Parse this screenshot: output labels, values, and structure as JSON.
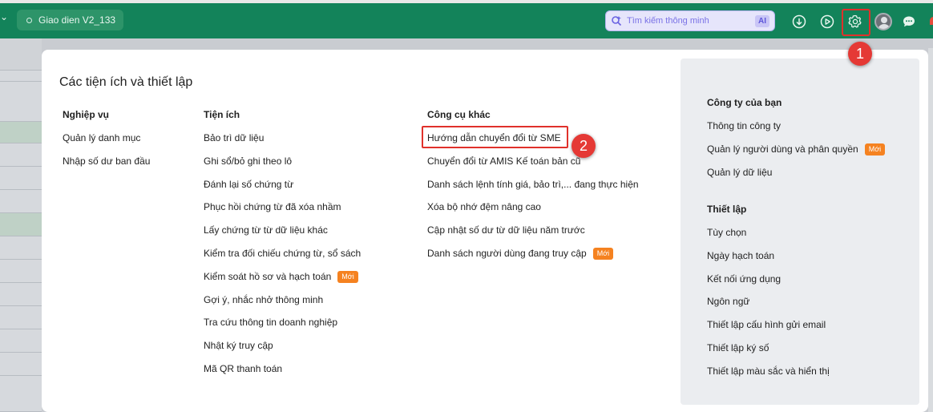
{
  "topbar": {
    "db_name": "Giao dien V2_133",
    "search_placeholder": "Tìm kiếm thông minh",
    "ai_label": "AI"
  },
  "panel": {
    "title": "Các tiện ích và thiết lập",
    "columns": [
      {
        "heading": "Nghiệp vụ",
        "items": [
          "Quản lý danh mục",
          "Nhập số dư ban đầu"
        ]
      },
      {
        "heading": "Tiện ích",
        "items": [
          "Bảo trì dữ liệu",
          "Ghi sổ/bỏ ghi theo lô",
          "Đánh lại số chứng từ",
          "Phục hồi chứng từ đã xóa nhầm",
          "Lấy chứng từ từ dữ liệu khác",
          "Kiểm tra đối chiếu chứng từ, sổ sách",
          "Kiểm soát hồ sơ và hạch toán",
          "Gợi ý, nhắc nhở thông minh",
          "Tra cứu thông tin doanh nghiệp",
          "Nhật ký truy cập",
          "Mã QR thanh toán"
        ]
      },
      {
        "heading": "Công cụ khác",
        "items": [
          "Hướng dẫn chuyển đổi từ SME",
          "Chuyển đổi từ AMIS Kế toán bản cũ",
          "Danh sách lệnh tính giá, bảo trì,... đang thực hiện",
          "Xóa bộ nhớ đệm nâng cao",
          "Cập nhật số dư từ dữ liệu năm trước",
          "Danh sách người dùng đang truy cập"
        ]
      }
    ],
    "side": {
      "company_heading": "Công ty của bạn",
      "company_items": [
        "Thông tin công ty",
        "Quản lý người dùng và phân quyền",
        "Quản lý dữ liệu"
      ],
      "settings_heading": "Thiết lập",
      "settings_items": [
        "Tùy chọn",
        "Ngày hạch toán",
        "Kết nối ứng dụng",
        "Ngôn ngữ",
        "Thiết lập cấu hình gửi email",
        "Thiết lập ký số",
        "Thiết lập màu sắc và hiển thị"
      ]
    },
    "new_badge": "Mới"
  },
  "callouts": {
    "one": "1",
    "two": "2"
  },
  "colors": {
    "topbar": "#13835a",
    "highlight": "#e0312b",
    "badge": "#f58220"
  }
}
